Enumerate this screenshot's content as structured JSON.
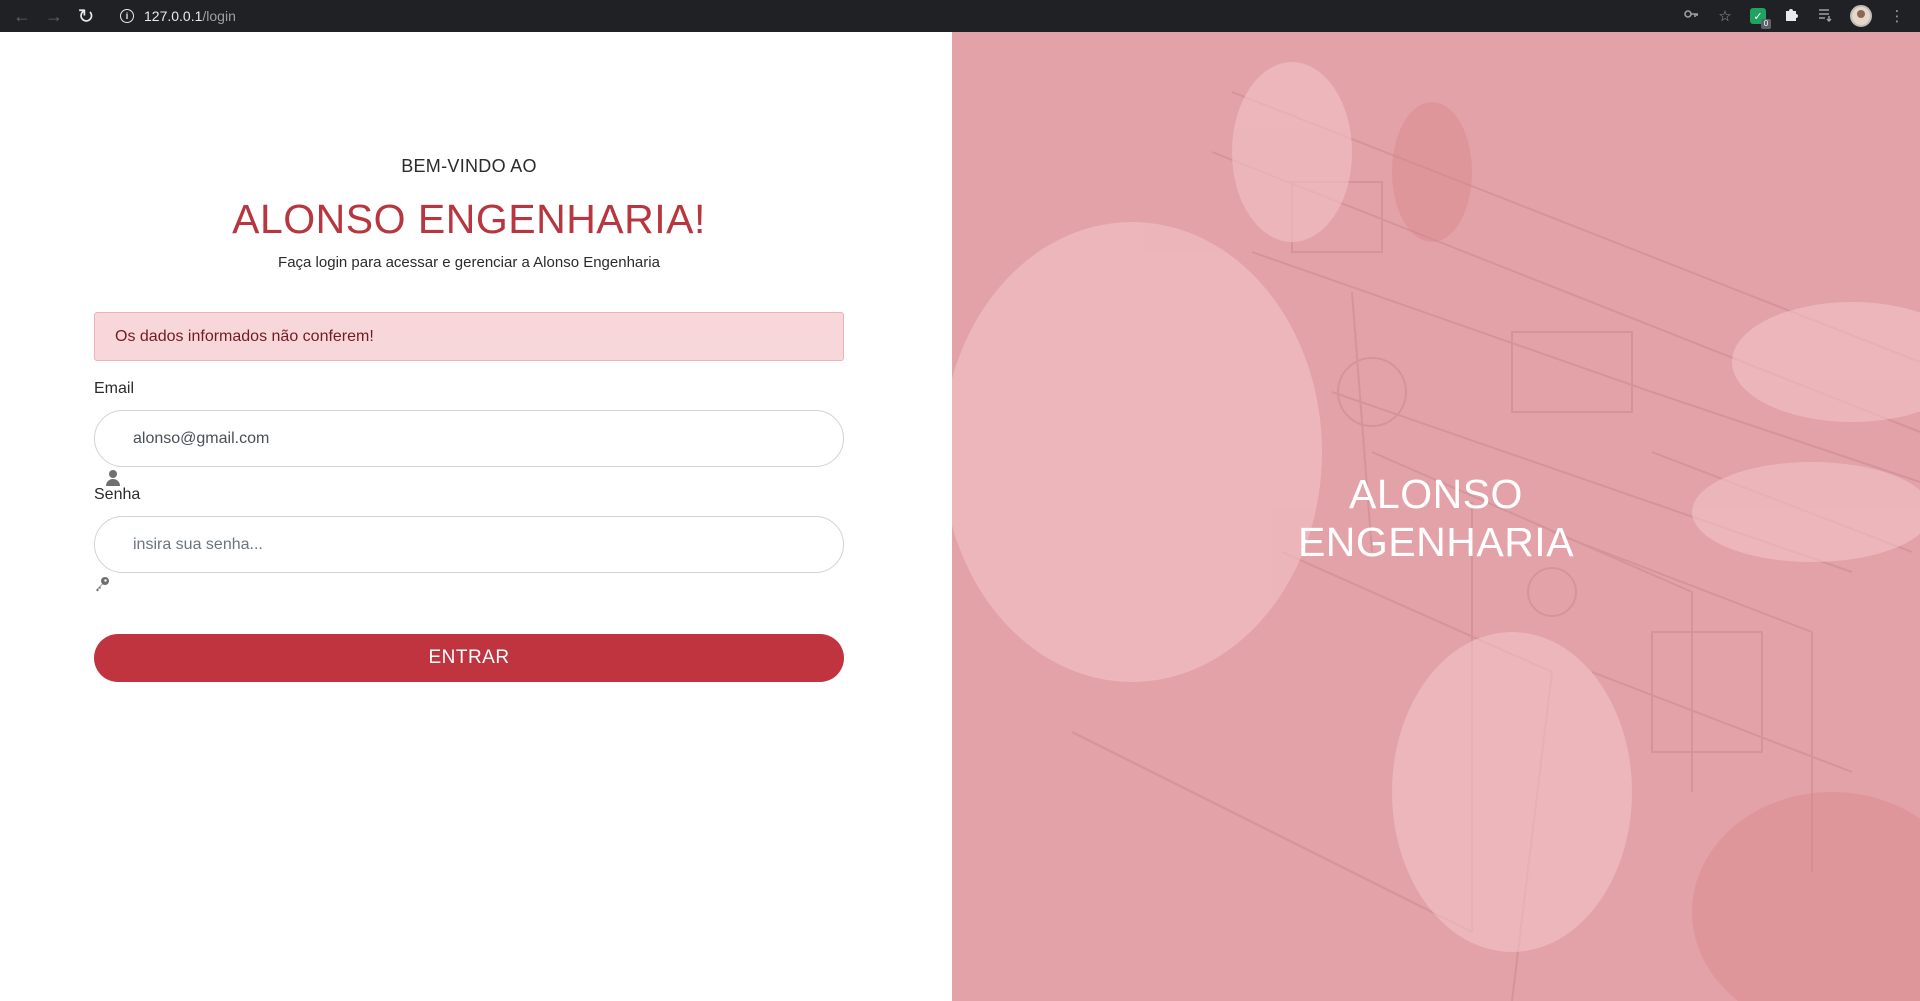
{
  "browser": {
    "url_host": "127.0.0.1",
    "url_path": "/login",
    "extension_badge": "0"
  },
  "login": {
    "welcome": "BEM-VINDO AO",
    "title": "ALONSO ENGENHARIA!",
    "subtitle": "Faça login para acessar e gerenciar a Alonso Engenharia",
    "alert": "Os dados informados não conferem!",
    "email_label": "Email",
    "email_value": "alonso@gmail.com",
    "password_label": "Senha",
    "password_placeholder": "insira sua senha...",
    "submit_label": "ENTRAR"
  },
  "hero": {
    "line1": "ALONSO",
    "line2": "ENGENHARIA"
  },
  "colors": {
    "brand": "#c0343f",
    "title": "#b8363f",
    "alert_bg": "#f8d7da",
    "alert_text": "#721c24",
    "hero_overlay": "#e3a2a7",
    "chrome": "#202124"
  },
  "icons": [
    "back-arrow-icon",
    "forward-arrow-icon",
    "reload-icon",
    "info-icon",
    "key-icon",
    "star-icon",
    "shield-extension-icon",
    "puzzle-icon",
    "reading-list-icon",
    "menu-icon",
    "user-icon"
  ]
}
